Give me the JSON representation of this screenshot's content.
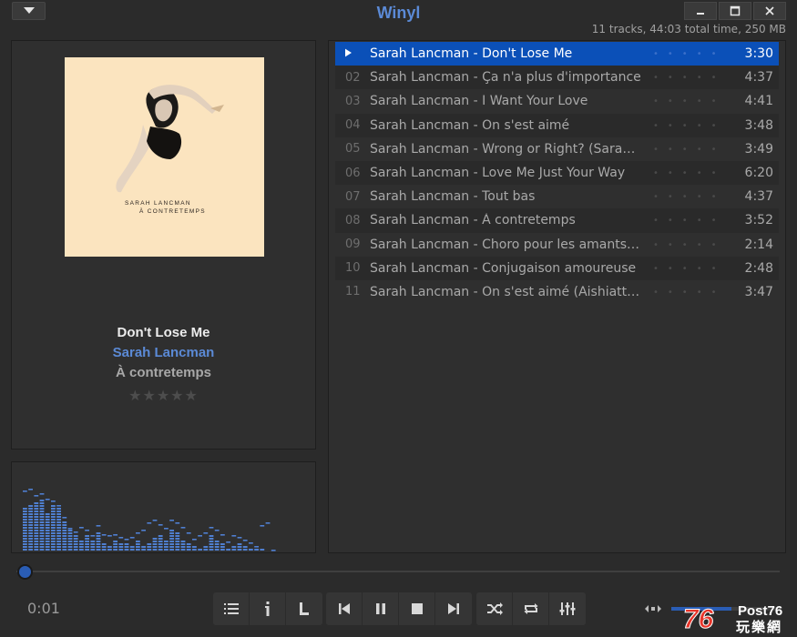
{
  "app": {
    "title": "Winyl",
    "summary": "11 tracks, 44:03 total time, 250 MB"
  },
  "window_controls": {
    "menu_icon": "dropdown-arrow-icon",
    "minimize_icon": "minimize-icon",
    "maximize_icon": "maximize-icon",
    "close_icon": "close-icon"
  },
  "now_playing": {
    "cover_text_line1": "SARAH LANCMAN",
    "cover_text_line2": "À CONTRETEMPS",
    "title": "Don't Lose Me",
    "artist": "Sarah Lancman",
    "album": "À contretemps",
    "rating_stars": "★★★★★",
    "rating_value": 0
  },
  "playlist": {
    "tracks": [
      {
        "num": "",
        "name": "Sarah Lancman - Don't Lose Me",
        "time": "3:30",
        "active": true
      },
      {
        "num": "02",
        "name": "Sarah Lancman - Ça n'a plus d'importance",
        "time": "4:37"
      },
      {
        "num": "03",
        "name": "Sarah Lancman - I Want Your Love",
        "time": "4:41"
      },
      {
        "num": "04",
        "name": "Sarah Lancman - On s'est aimé",
        "time": "3:48"
      },
      {
        "num": "05",
        "name": "Sarah Lancman - Wrong or Right? (Sarah's ...",
        "time": "3:49"
      },
      {
        "num": "06",
        "name": "Sarah Lancman - Love Me Just Your Way",
        "time": "6:20"
      },
      {
        "num": "07",
        "name": "Sarah Lancman - Tout bas",
        "time": "4:37"
      },
      {
        "num": "08",
        "name": "Sarah Lancman - À contretemps",
        "time": "3:52"
      },
      {
        "num": "09",
        "name": "Sarah Lancman - Choro pour les amants ét...",
        "time": "2:14"
      },
      {
        "num": "10",
        "name": "Sarah Lancman - Conjugaison amoureuse",
        "time": "2:48"
      },
      {
        "num": "11",
        "name": "Sarah Lancman - On s'est aimé (Aishiatta k...",
        "time": "3:47"
      }
    ],
    "rating_dots": "•••••"
  },
  "playback": {
    "elapsed": "0:01",
    "progress": 0.004,
    "volume": 0.55
  },
  "visualizer": {
    "levels": [
      0.62,
      0.66,
      0.68,
      0.72,
      0.55,
      0.66,
      0.6,
      0.44,
      0.3,
      0.22,
      0.18,
      0.24,
      0.16,
      0.28,
      0.12,
      0.1,
      0.18,
      0.14,
      0.12,
      0.08,
      0.16,
      0.1,
      0.14,
      0.2,
      0.22,
      0.16,
      0.3,
      0.26,
      0.18,
      0.12,
      0.08,
      0.06,
      0.1,
      0.22,
      0.16,
      0.12,
      0.06,
      0.1,
      0.14,
      0.08,
      0.04,
      0.04,
      0.06,
      0.02,
      0.02
    ],
    "peaks": [
      0.84,
      0.86,
      0.78,
      0.8,
      0.72,
      0.7,
      0.64,
      0.48,
      0.32,
      0.28,
      0.34,
      0.3,
      0.22,
      0.36,
      0.24,
      0.22,
      0.24,
      0.2,
      0.18,
      0.2,
      0.26,
      0.3,
      0.4,
      0.44,
      0.38,
      0.32,
      0.44,
      0.4,
      0.34,
      0.26,
      0.18,
      0.22,
      0.26,
      0.34,
      0.3,
      0.24,
      0.14,
      0.22,
      0.2,
      0.16,
      0.12,
      0.08,
      0.36,
      0.4,
      0.02
    ],
    "color": "#4f7fd0"
  },
  "controls": {
    "playlist_icon": "playlist-icon",
    "info_icon": "info-icon",
    "lyrics_icon": "lyrics-icon",
    "prev_icon": "previous-icon",
    "pause_icon": "pause-icon",
    "stop_icon": "stop-icon",
    "next_icon": "next-icon",
    "shuffle_icon": "shuffle-icon",
    "repeat_icon": "repeat-icon",
    "equalizer_icon": "equalizer-icon",
    "mute_icon": "volume-icon"
  },
  "watermark": {
    "brand": "Post76",
    "number": "76",
    "subtitle": "玩樂網"
  },
  "colors": {
    "accent": "#5b8ad6",
    "selection": "#0b50b8",
    "background": "#2b2b2b"
  }
}
